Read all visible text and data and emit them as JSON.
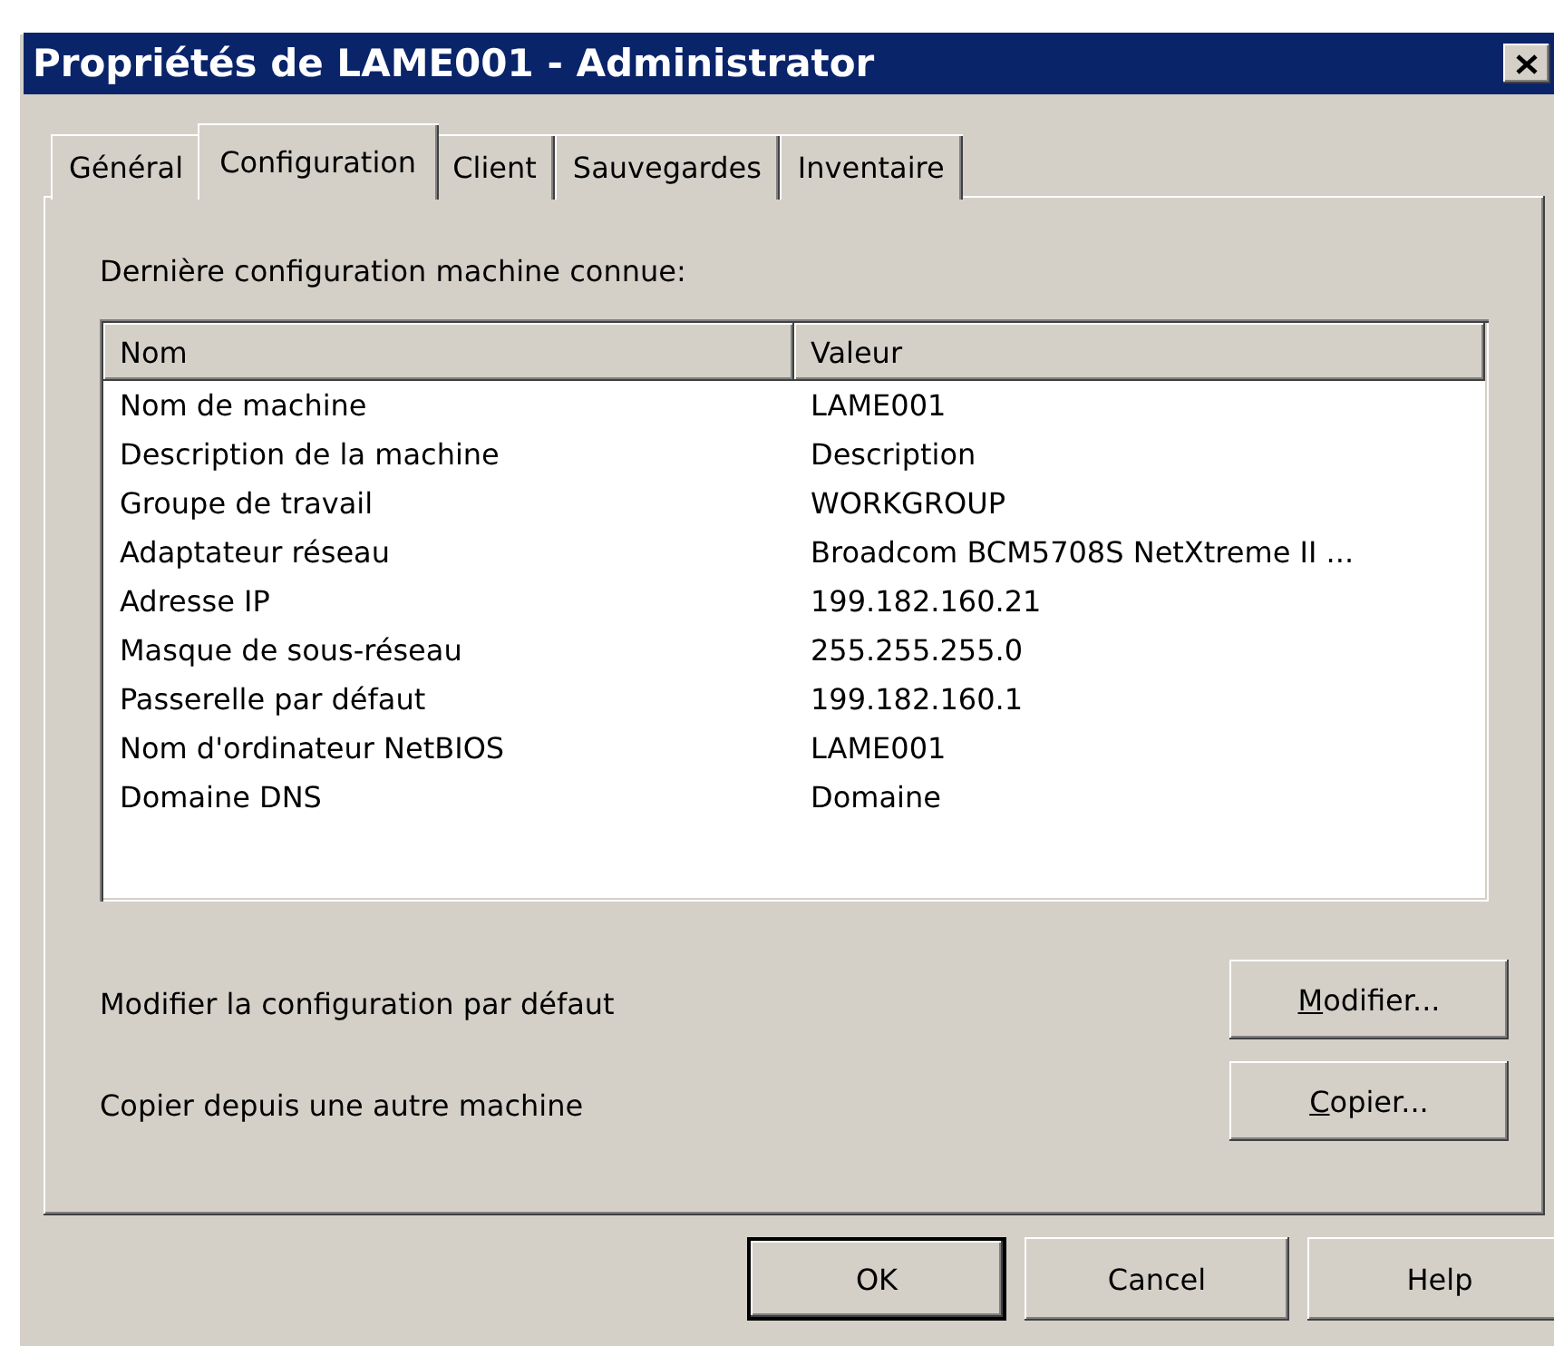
{
  "window": {
    "title": "Propriétés de LAME001 - Administrator"
  },
  "tabs": [
    {
      "label": "Général",
      "selected": false
    },
    {
      "label": "Configuration",
      "selected": true
    },
    {
      "label": "Client",
      "selected": false
    },
    {
      "label": "Sauvegardes",
      "selected": false
    },
    {
      "label": "Inventaire",
      "selected": false
    }
  ],
  "panel": {
    "caption": "Dernière configuration machine connue:",
    "table": {
      "columns": [
        "Nom",
        "Valeur"
      ],
      "rows": [
        [
          "Nom de machine",
          "LAME001"
        ],
        [
          "Description de la machine",
          "Description"
        ],
        [
          "Groupe de travail",
          "WORKGROUP"
        ],
        [
          "Adaptateur réseau",
          "Broadcom BCM5708S NetXtreme II ..."
        ],
        [
          "Adresse IP",
          "199.182.160.21"
        ],
        [
          "Masque de sous-réseau",
          "255.255.255.0"
        ],
        [
          "Passerelle par défaut",
          "199.182.160.1"
        ],
        [
          "Nom d'ordinateur NetBIOS",
          "LAME001"
        ],
        [
          "Domaine DNS",
          "Domaine"
        ]
      ]
    },
    "actions": [
      {
        "label": "Modifier la configuration par défaut",
        "button": "Modifier...",
        "first_letter_underlined": true
      },
      {
        "label": "Copier depuis une autre machine",
        "button": "Copier...",
        "first_letter_underlined": true
      }
    ]
  },
  "buttons": [
    {
      "label": "OK",
      "default": true
    },
    {
      "label": "Cancel",
      "default": false
    },
    {
      "label": "Help",
      "default": false
    }
  ]
}
